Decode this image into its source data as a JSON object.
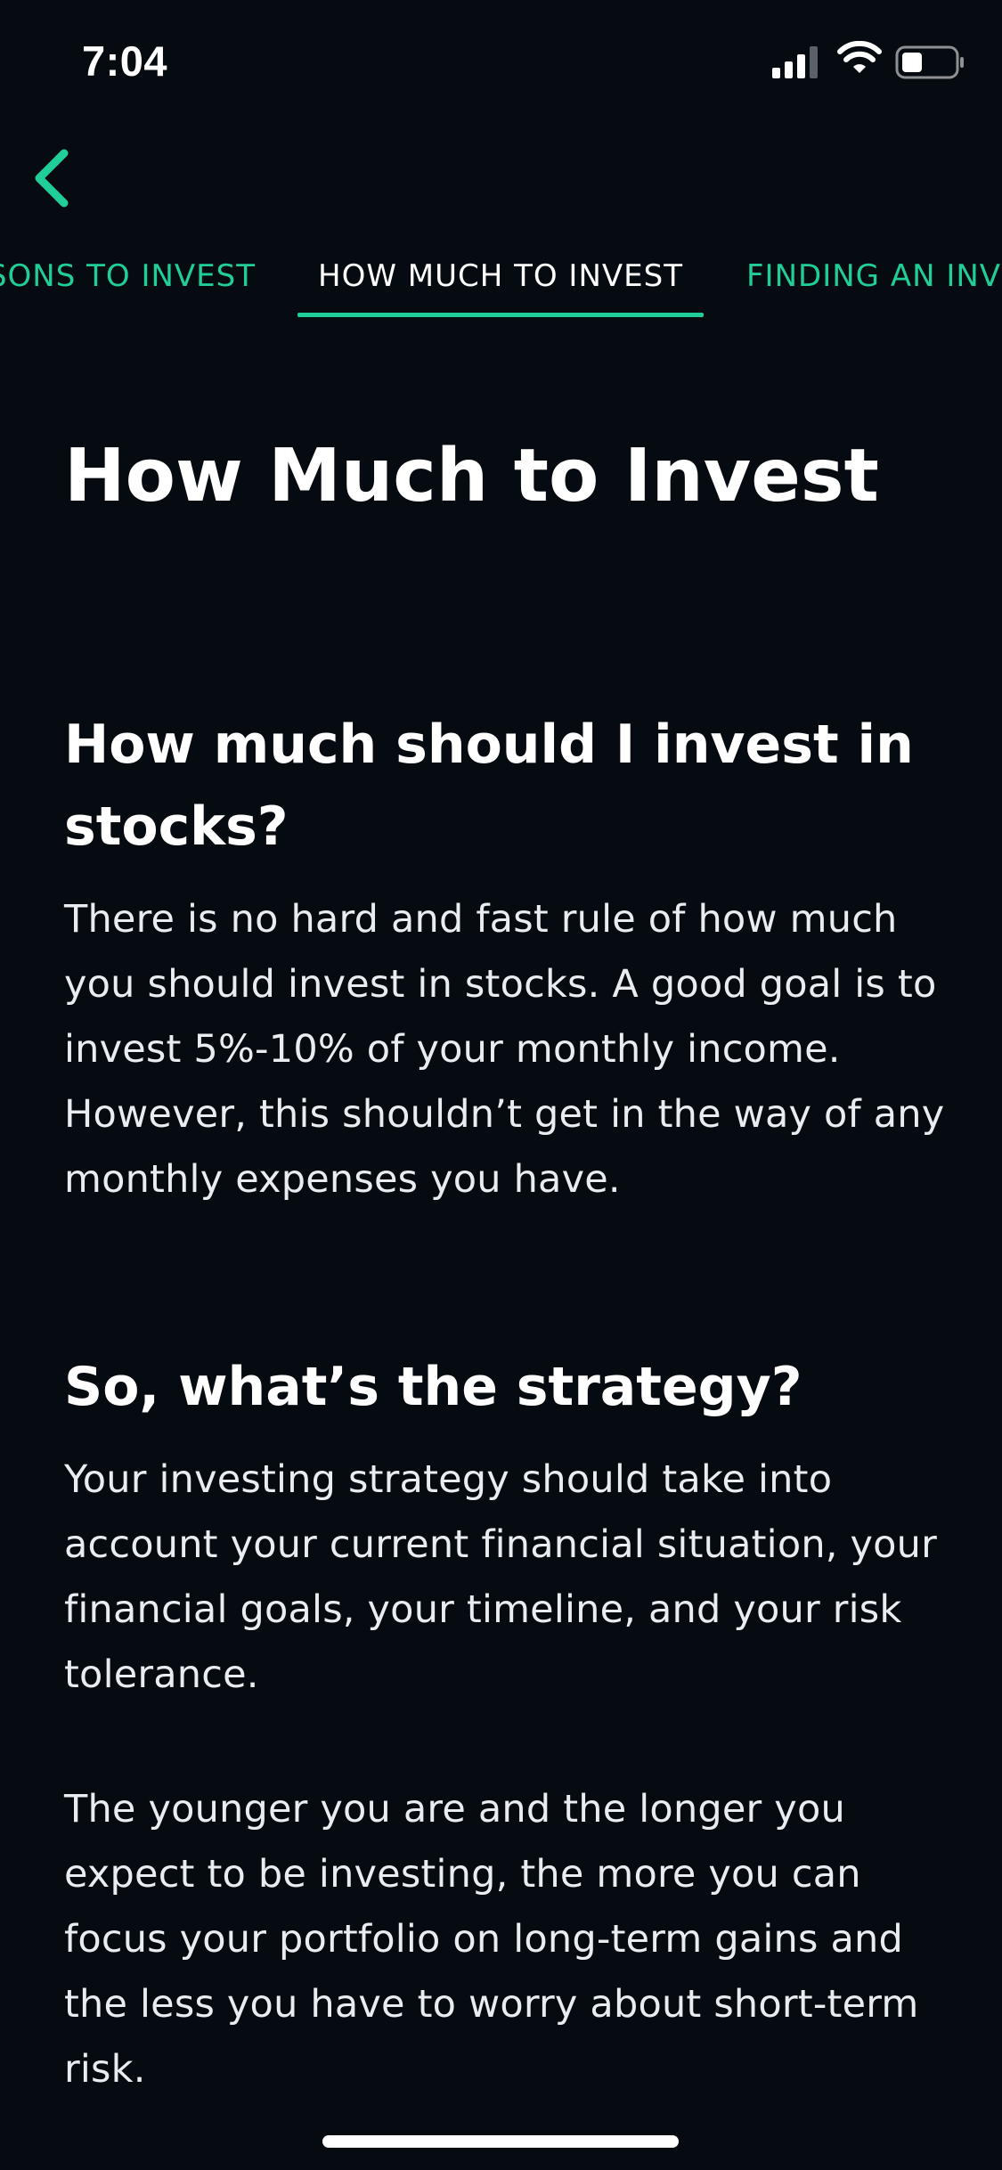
{
  "status_bar": {
    "time": "7:04"
  },
  "colors": {
    "background": "#060b11",
    "accent": "#21ce99",
    "text": "#ffffff"
  },
  "nav": {
    "back_icon": "chevron-left-icon"
  },
  "tabs": [
    {
      "label": "REASONS TO INVEST",
      "visible_text": "SONS TO INVEST"
    },
    {
      "label": "HOW MUCH TO INVEST",
      "active": true
    },
    {
      "label": "FINDING AN INV"
    }
  ],
  "article": {
    "title": "How Much to Invest",
    "section1_heading": "How much should I invest in stocks?",
    "section1_paragraph": "There is no hard and fast rule of how much you should invest in stocks. A good goal is to invest 5%-10% of your monthly income. However, this shouldn’t get in the way of any monthly expenses you have.",
    "section2_heading": "So, what’s the strategy?",
    "section2_paragraph1": "Your investing strategy should take into account your current financial situation, your financial goals, your timeline, and your risk tolerance.",
    "section2_paragraph2": "The younger you are and the longer you expect to be investing, the more you can focus your portfolio on long-term gains and the less you have to worry about short-term risk."
  }
}
